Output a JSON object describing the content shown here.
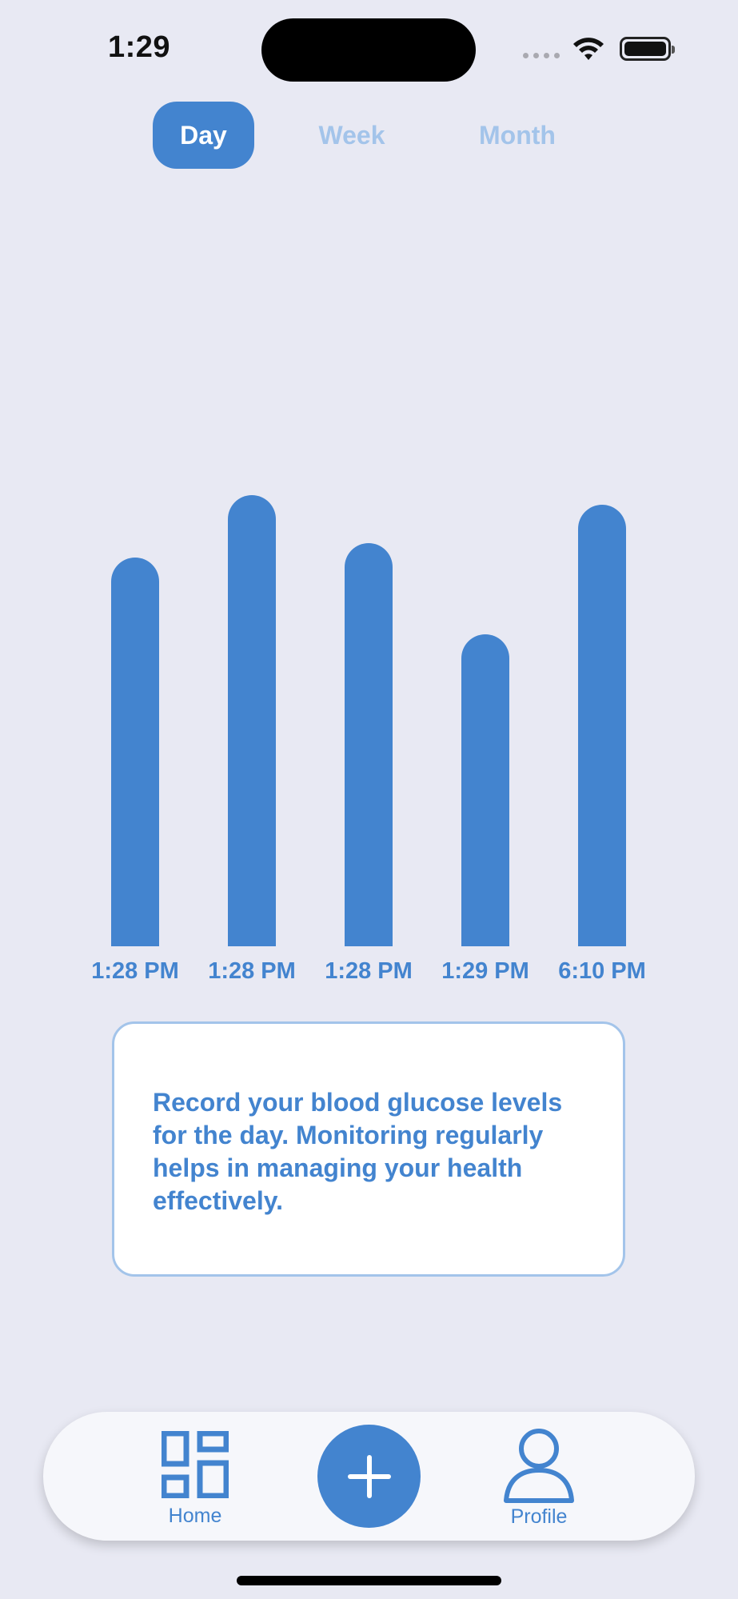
{
  "status_bar": {
    "time": "1:29"
  },
  "range_tabs": [
    {
      "label": "Day",
      "selected": true
    },
    {
      "label": "Week",
      "selected": false
    },
    {
      "label": "Month",
      "selected": false
    }
  ],
  "chart_data": {
    "type": "bar",
    "categories": [
      "1:28 PM",
      "1:28 PM",
      "1:28 PM",
      "1:29 PM",
      "6:10 PM"
    ],
    "values": [
      0.81,
      0.94,
      0.84,
      0.65,
      0.92
    ],
    "value_scale": "relative bar height (no axis printed)",
    "color": "#4384cf"
  },
  "info_card": {
    "text": "Record your blood glucose levels for the day. Monitoring regularly helps in managing your health effectively."
  },
  "tab_bar": {
    "home_label": "Home",
    "profile_label": "Profile",
    "home_icon": "grid-icon",
    "add_icon": "plus-icon",
    "profile_icon": "person-icon"
  },
  "colors": {
    "background": "#e8e9f3",
    "accent": "#4384cf",
    "inactive": "#a3c4ea"
  }
}
